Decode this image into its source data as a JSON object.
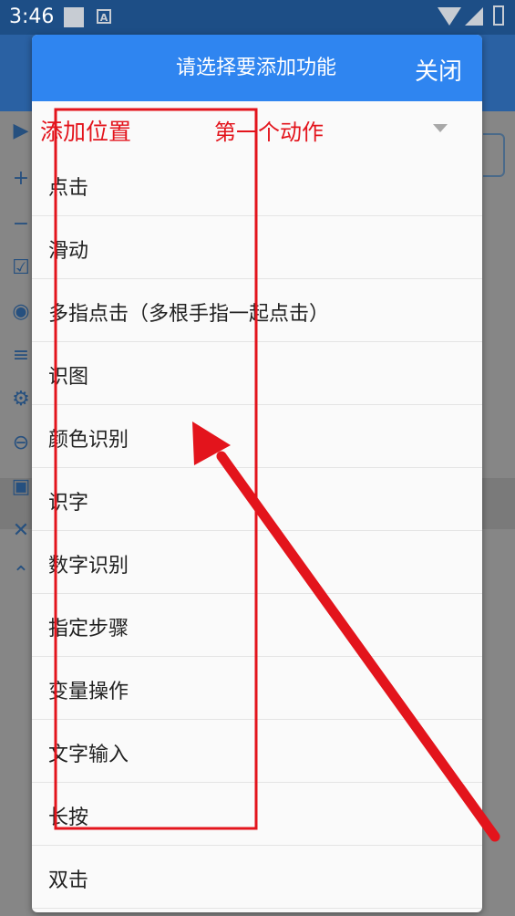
{
  "status_bar": {
    "time": "3:46",
    "notification_icon": "A"
  },
  "dialog": {
    "title": "请选择要添加功能",
    "close_label": "关闭",
    "position_label": "添加位置",
    "position_value": "第一个动作",
    "items": [
      "点击",
      "滑动",
      "多指点击（多根手指一起点击）",
      "识图",
      "颜色识别",
      "识字",
      "数字识别",
      "指定步骤",
      "变量操作",
      "文字输入",
      "长按",
      "双击"
    ]
  },
  "colors": {
    "status_bar": "#1d4e86",
    "dialog_header": "#2f85f0",
    "annotation_red": "#e3141c"
  }
}
